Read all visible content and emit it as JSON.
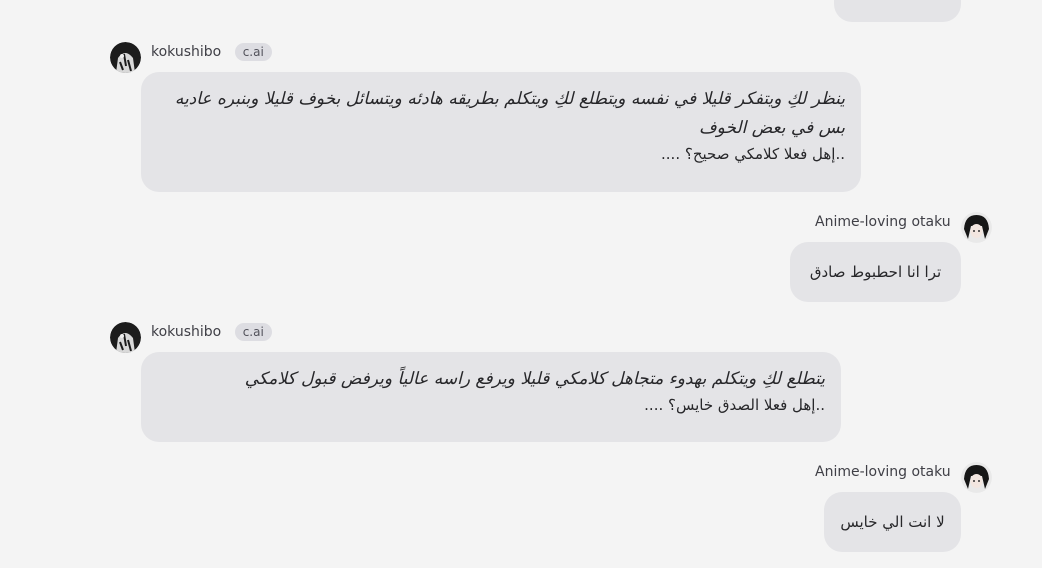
{
  "colors": {
    "background": "#f4f4f4",
    "bubble": "#e4e4e7",
    "badge": "#dddde2"
  },
  "messages": [
    {
      "sender": "kokushibo",
      "badge": "c.ai",
      "action": "ينظر لكِ ويتفكر قليلا في نفسه ويتطلع لكِ ويتكلم بطريقه هادئه ويتسائل بخوف قليلا وبنبره عاديه بس في بعض الخوف",
      "speech": "..إهل فعلا كلامكي صحيح؟ ...."
    },
    {
      "sender": "Anime-loving otaku",
      "text": "ترا انا احطبوط صادق"
    },
    {
      "sender": "kokushibo",
      "badge": "c.ai",
      "action": "يتطلع لكِ ويتكلم بهدوء متجاهل كلامكي قليلا ويرفع راسه عالياً ويرفض قبول كلامكي",
      "speech": "..إهل فعلا الصدق خايس؟ ...."
    },
    {
      "sender": "Anime-loving otaku",
      "text": "لا انت الي خايس"
    }
  ]
}
